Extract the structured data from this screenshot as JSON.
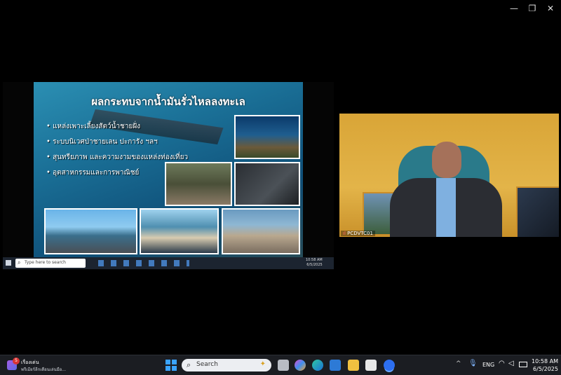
{
  "window": {
    "minimize_icon": "minimize-icon",
    "restore_icon": "restore-icon",
    "close_icon": "close-icon"
  },
  "slide": {
    "title": "ผลกระทบจากน้ำมันรั่วไหลลงทะเล",
    "bullets": [
      "แหล่งเพาะเลี้ยงสัตว์น้ำชายฝั่ง",
      "ระบบนิเวศป่าชายเลน ปะการัง ฯลฯ",
      "สุนทรียภาพ และความงามของแหล่งท่องเที่ยว",
      "อุตสาหกรรมและการพาณิชย์"
    ]
  },
  "inner_taskbar": {
    "search_placeholder": "Type here to search",
    "time": "10:58 AM",
    "date": "6/5/2025"
  },
  "video": {
    "participant_label": "PCDVTC01"
  },
  "taskbar": {
    "news_badge": "5",
    "news_title": "เรื่องเด่น",
    "news_subtitle": "พรีเมียร์ลีกเตือนเล่นมือ...",
    "search_placeholder": "Search",
    "language": "ENG",
    "time": "10:58 AM",
    "date": "6/5/2025"
  },
  "colors": {
    "taskbar_bg": "#1b1d22",
    "video_bg": "#e3b449",
    "accent_blue": "#3a8ee6"
  }
}
